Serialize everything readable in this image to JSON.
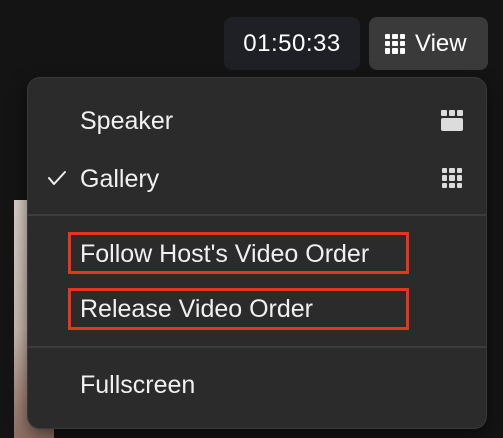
{
  "timer": {
    "elapsed": "01:50:33"
  },
  "view_button": {
    "label": "View",
    "icon": "grid-icon"
  },
  "view_menu": {
    "items": [
      {
        "label": "Speaker",
        "icon": "speaker-view-icon",
        "checked": false
      },
      {
        "label": "Gallery",
        "icon": "gallery-view-icon",
        "checked": true
      },
      {
        "label": "Follow Host's Video Order",
        "highlighted": true
      },
      {
        "label": "Release Video Order",
        "highlighted": true
      },
      {
        "label": "Fullscreen"
      }
    ]
  },
  "colors": {
    "background": "#141414",
    "menu_background": "#2b2b2b",
    "timer_background": "#1f2026",
    "view_button_background": "#3a3a3a",
    "highlight": "#e8341c",
    "text": "#f0f0f0"
  }
}
